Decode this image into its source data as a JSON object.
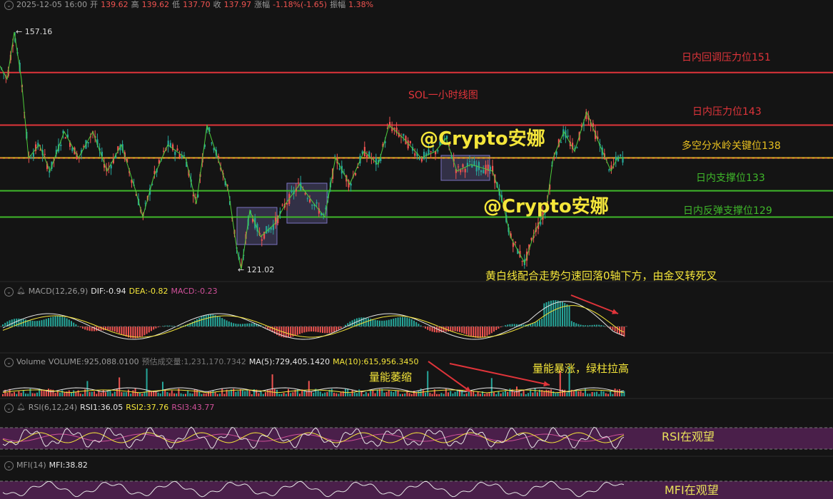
{
  "header": {
    "datetime": "2025-12-05 16:00",
    "open_label": "开",
    "open": "139.62",
    "high_label": "高",
    "high": "139.62",
    "low_label": "低",
    "low": "137.70",
    "close_label": "收",
    "close": "137.97",
    "change_label": "涨幅",
    "change": "-1.18%(-1.65)",
    "amp_label": "振幅",
    "amp": "1.38%"
  },
  "price_chart": {
    "title": "SOL一小时线图",
    "high_marker": "157.16",
    "low_marker": "121.02",
    "watermark": "@Crypto安娜",
    "levels": [
      {
        "label": "日内回调压力位151",
        "value": 151,
        "color": "#e0343a"
      },
      {
        "label": "日内压力位143",
        "value": 143,
        "color": "#e0343a"
      },
      {
        "label": "多空分水岭关键位138",
        "value": 138,
        "color": "#e8c020"
      },
      {
        "label": "日内支撑位133",
        "value": 133,
        "color": "#3fb82a"
      },
      {
        "label": "日内反弹支撑位129",
        "value": 129,
        "color": "#3fb82a"
      }
    ]
  },
  "macd": {
    "name": "MACD(12,26,9)",
    "dif": "DIF:-0.94",
    "dea": "DEA:-0.82",
    "macd": "MACD:-0.23",
    "note": "黄白线配合走势匀速回落0轴下方，由金叉转死叉"
  },
  "volume": {
    "name": "Volume",
    "vol": "VOLUME:925,088.0100",
    "est": "预估成交量:1,231,170.7342",
    "ma5": "MA(5):729,405.1420",
    "ma10": "MA(10):615,956.3450",
    "note_shrink": "量能萎缩",
    "note_surge": "量能暴涨，绿柱拉高"
  },
  "rsi": {
    "name": "RSI(6,12,24)",
    "rsi1": "RSI1:36.05",
    "rsi2": "RSI2:37.76",
    "rsi3": "RSI3:43.77",
    "band_label": "RSI在观望"
  },
  "mfi": {
    "name": "MFI(14)",
    "mfi": "MFI:38.82",
    "band_label": "MFI在观望"
  },
  "colors": {
    "up": "#26a69a",
    "down": "#ef5350",
    "bg": "#141414",
    "yellow": "#f5e63a",
    "band": "#4a1f4a"
  },
  "chart_data": {
    "type": "candlestick",
    "title": "SOL一小时线图",
    "price_range": [
      121.02,
      157.16
    ],
    "key_levels": [
      151,
      143,
      138,
      133,
      129
    ],
    "last": {
      "open": 139.62,
      "high": 139.62,
      "low": 137.7,
      "close": 137.97
    },
    "macd": {
      "dif": -0.94,
      "dea": -0.82,
      "macd": -0.23
    },
    "volume": {
      "volume": 925088.01,
      "estimated": 1231170.7342,
      "ma5": 729405.142,
      "ma10": 615956.345
    },
    "rsi": {
      "rsi1": 36.05,
      "rsi2": 37.76,
      "rsi3": 43.77
    },
    "mfi": 38.82
  }
}
